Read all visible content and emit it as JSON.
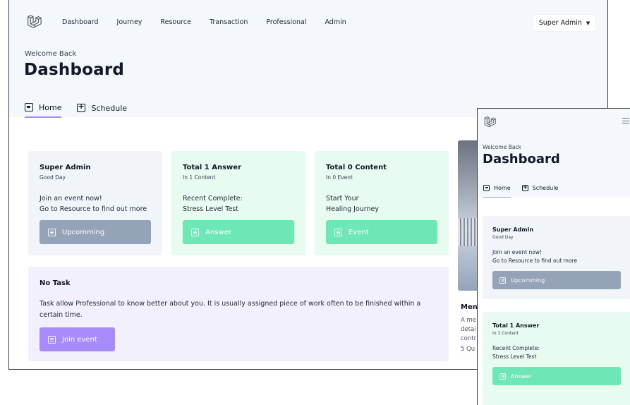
{
  "desktop": {
    "nav": {
      "links": [
        "Dashboard",
        "Journey",
        "Resource",
        "Transaction",
        "Professional",
        "Admin"
      ],
      "user_menu": "Super Admin"
    },
    "welcome": "Welcome Back",
    "title": "Dashboard",
    "tabs": [
      {
        "label": "Home",
        "icon": "home-icon",
        "active": true
      },
      {
        "label": "Schedule",
        "icon": "schedule-plus-icon",
        "active": false
      }
    ],
    "cards": [
      {
        "title": "Super Admin",
        "subtitle": "Good Day",
        "lines": [
          "Join an event now!",
          "Go to Resource to find out more"
        ],
        "button": "Upcomming",
        "color": "#94a3b8"
      },
      {
        "title": "Total 1 Answer",
        "subtitle": "In 1 Content",
        "lines": [
          "Recent Complete:",
          "Stress Level Test"
        ],
        "button": "Answer",
        "color": "#6ee7b7"
      },
      {
        "title": "Total 0 Content",
        "subtitle": "In 0 Event",
        "lines": [
          "Start Your",
          "Healing Journey"
        ],
        "button": "Event",
        "color": "#6ee7b7"
      }
    ],
    "task": {
      "title": "No Task",
      "description": "Task allow Professional to know better about you. It is usually assigned piece of work often to be finished within a certain time.",
      "button": "Join event",
      "color": "#a78bfa"
    },
    "side": {
      "title": "Men",
      "desc_lines": [
        "A me",
        "detai",
        "contr"
      ],
      "meta": "5 Qu"
    }
  },
  "mobile": {
    "welcome": "Welcome Back",
    "title": "Dashboard",
    "tabs": [
      {
        "label": "Home",
        "active": true
      },
      {
        "label": "Schedule",
        "active": false
      }
    ],
    "cards": [
      {
        "title": "Super Admin",
        "subtitle": "Good Day",
        "lines": [
          "Join an event now!",
          "Go to Resource to find out more"
        ],
        "button": "Upcomming"
      },
      {
        "title": "Total 1 Answer",
        "subtitle": "In 1 Content",
        "lines": [
          "Recent Complete:",
          "Stress Level Test"
        ],
        "button": "Answer"
      }
    ]
  }
}
